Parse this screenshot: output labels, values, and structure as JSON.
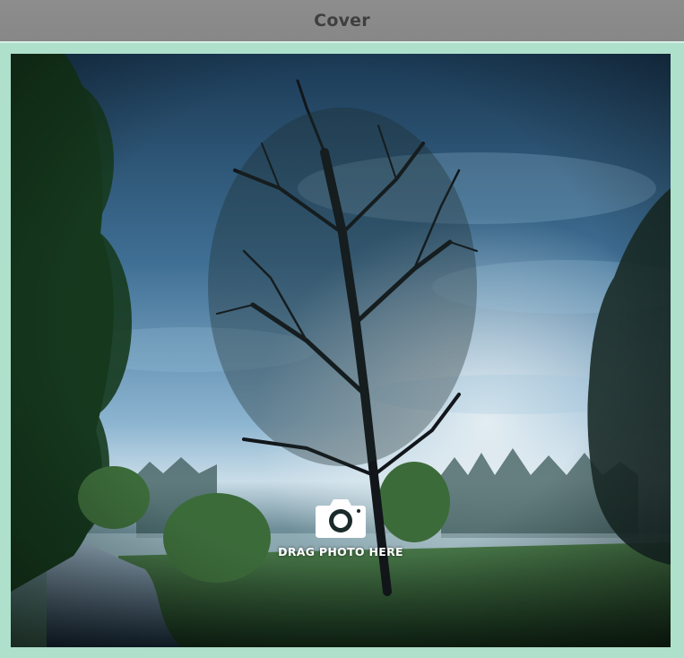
{
  "window": {
    "title": "Cover"
  },
  "cover": {
    "hint": "DRAG PHOTO HERE",
    "icon": "camera-icon",
    "photo_subject": "landscape-photo"
  },
  "colors": {
    "frame": "#aee0cc",
    "titlebar": "#8a8a8a",
    "title_text": "#3f3f3f"
  }
}
